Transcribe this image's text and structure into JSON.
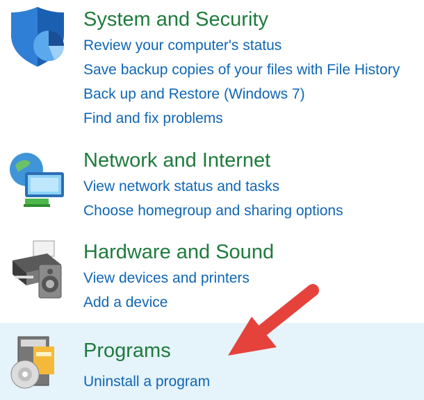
{
  "categories": [
    {
      "title": "System and Security",
      "icon": "shield-icon",
      "links": [
        "Review your computer's status",
        "Save backup copies of your files with File History",
        "Back up and Restore (Windows 7)",
        "Find and fix problems"
      ]
    },
    {
      "title": "Network and Internet",
      "icon": "network-globe-icon",
      "links": [
        "View network status and tasks",
        "Choose homegroup and sharing options"
      ]
    },
    {
      "title": "Hardware and Sound",
      "icon": "printer-speaker-icon",
      "links": [
        "View devices and printers",
        "Add a device"
      ]
    },
    {
      "title": "Programs",
      "icon": "programs-disc-icon",
      "links": [
        "Uninstall a program"
      ]
    }
  ],
  "annotation": {
    "icon": "red-arrow-icon",
    "color": "#e5423c"
  },
  "colors": {
    "title": "#1e7b3c",
    "link": "#0f66b6",
    "highlight": "#e5f3fb"
  }
}
